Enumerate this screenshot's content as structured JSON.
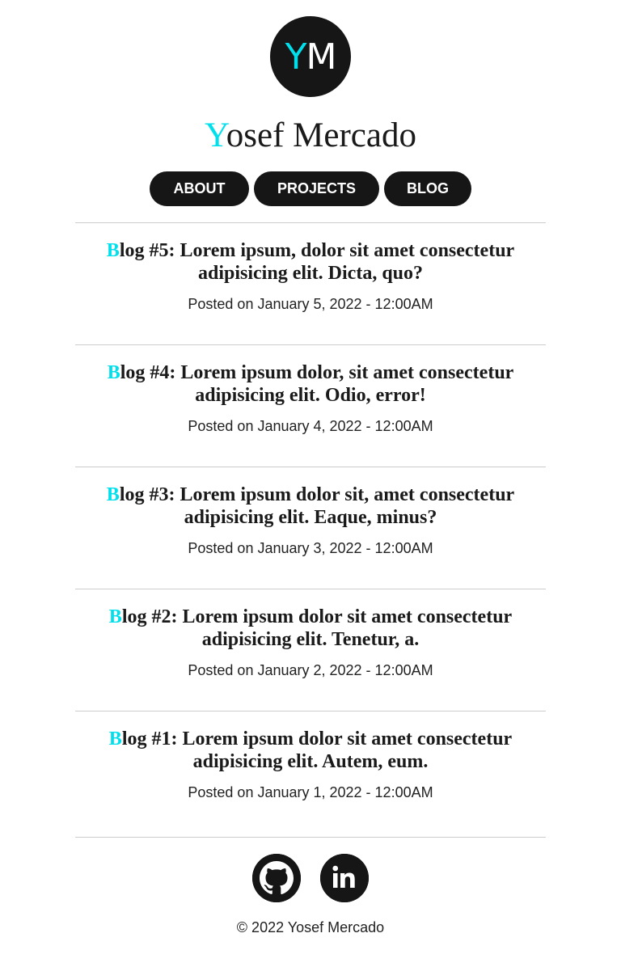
{
  "logo": {
    "initial_first": "Y",
    "initial_second": "M"
  },
  "site_title": {
    "first_letter": "Y",
    "rest": "osef Mercado"
  },
  "nav": [
    {
      "label": "ABOUT"
    },
    {
      "label": "PROJECTS"
    },
    {
      "label": "BLOG"
    }
  ],
  "posts": [
    {
      "first_letter": "B",
      "title_rest": "log #5: Lorem ipsum, dolor sit amet consectetur adipisicing elit. Dicta, quo?",
      "meta_prefix": "Posted on",
      "date": "January 5, 2022 - 12:00AM"
    },
    {
      "first_letter": "B",
      "title_rest": "log #4: Lorem ipsum dolor, sit amet consectetur adipisicing elit. Odio, error!",
      "meta_prefix": "Posted on",
      "date": "January 4, 2022 - 12:00AM"
    },
    {
      "first_letter": "B",
      "title_rest": "log #3: Lorem ipsum dolor sit, amet consectetur adipisicing elit. Eaque, minus?",
      "meta_prefix": "Posted on",
      "date": "January 3, 2022 - 12:00AM"
    },
    {
      "first_letter": "B",
      "title_rest": "log #2: Lorem ipsum dolor sit amet consectetur adipisicing elit. Tenetur, a.",
      "meta_prefix": "Posted on",
      "date": "January 2, 2022 - 12:00AM"
    },
    {
      "first_letter": "B",
      "title_rest": "log #1: Lorem ipsum dolor sit amet consectetur adipisicing elit. Autem, eum.",
      "meta_prefix": "Posted on",
      "date": "January 1, 2022 - 12:00AM"
    }
  ],
  "socials": [
    {
      "icon": "github-icon"
    },
    {
      "icon": "linkedin-icon"
    }
  ],
  "footer": {
    "copyright": "© 2022 Yosef Mercado"
  },
  "colors": {
    "accent": "#00e0ec",
    "dark": "#161616"
  }
}
